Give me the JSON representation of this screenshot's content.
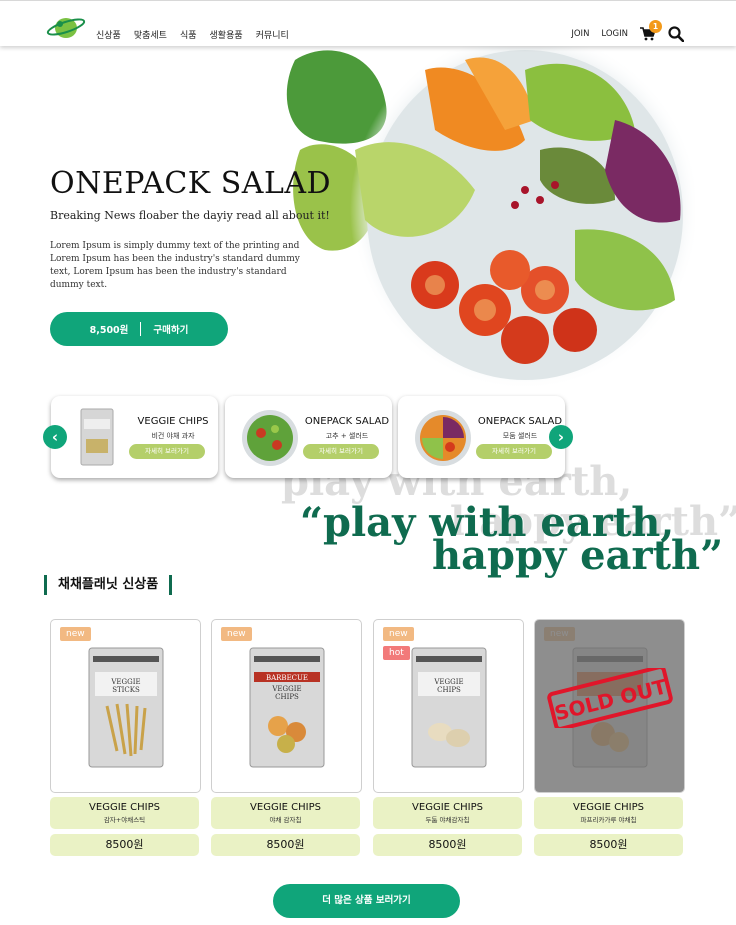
{
  "header": {
    "nav": [
      "신상품",
      "맞춤세트",
      "식품",
      "생활용품",
      "커뮤니티"
    ],
    "join": "JOIN",
    "login": "LOGIN",
    "cart_count": "1"
  },
  "hero": {
    "title": "ONEPACK SALAD",
    "subtitle": "Breaking News floaber the dayiy read all about it!",
    "description": "Lorem Ipsum is simply dummy text of the printing and Lorem Ipsum has been the industry's standard dummy text, Lorem Ipsum has been the industry's standard dummy text.",
    "price": "8,500원",
    "buy_label": "구매하기"
  },
  "slider": {
    "cards": [
      {
        "name": "VEGGIE CHIPS",
        "desc": "비건 야채 과자",
        "more": "자세히 보러가기"
      },
      {
        "name": "ONEPACK SALAD",
        "desc": "고추 + 샐러드",
        "more": "자세히 보러가기"
      },
      {
        "name": "ONEPACK SALAD",
        "desc": "모둠 샐러드",
        "more": "자세히 보러가기"
      }
    ],
    "prev": "‹",
    "next": "›"
  },
  "quote": {
    "line1": "“play with  earth,",
    "line2": "happy earth”"
  },
  "section": {
    "title": "채채플래닛 신상품"
  },
  "products": [
    {
      "tag": "new",
      "tag2": "",
      "name": "VEGGIE CHIPS",
      "desc": "감자+야채스틱",
      "price": "8500원",
      "soldout": false,
      "bag_label": "VEGGIE STICKS",
      "bag_color": "#d8d8d8"
    },
    {
      "tag": "new",
      "tag2": "",
      "name": "VEGGIE CHIPS",
      "desc": "야채 감자칩",
      "price": "8500원",
      "soldout": false,
      "bag_label": "BARBECUE VEGGIE CHIPS",
      "bag_color": "#c0392b"
    },
    {
      "tag": "new",
      "tag2": "hot",
      "name": "VEGGIE CHIPS",
      "desc": "두툼 야채감자칩",
      "price": "8500원",
      "soldout": false,
      "bag_label": "VEGGIE CHIPS",
      "bag_color": "#d8d8d8"
    },
    {
      "tag": "new",
      "tag2": "",
      "name": "VEGGIE CHIPS",
      "desc": "파프리카가루 야채칩",
      "price": "8500원",
      "soldout": true,
      "bag_label": "VEGGIE CHIPS",
      "bag_color": "#e06a2c"
    }
  ],
  "soldout_text": "SOLD OUT",
  "more_button": "더 많은 상품 보러가기",
  "colors": {
    "accent": "#10a57a",
    "dark_green": "#0f6b4f",
    "light_green": "#eaf2c5",
    "badge_orange": "#f39a1a"
  }
}
